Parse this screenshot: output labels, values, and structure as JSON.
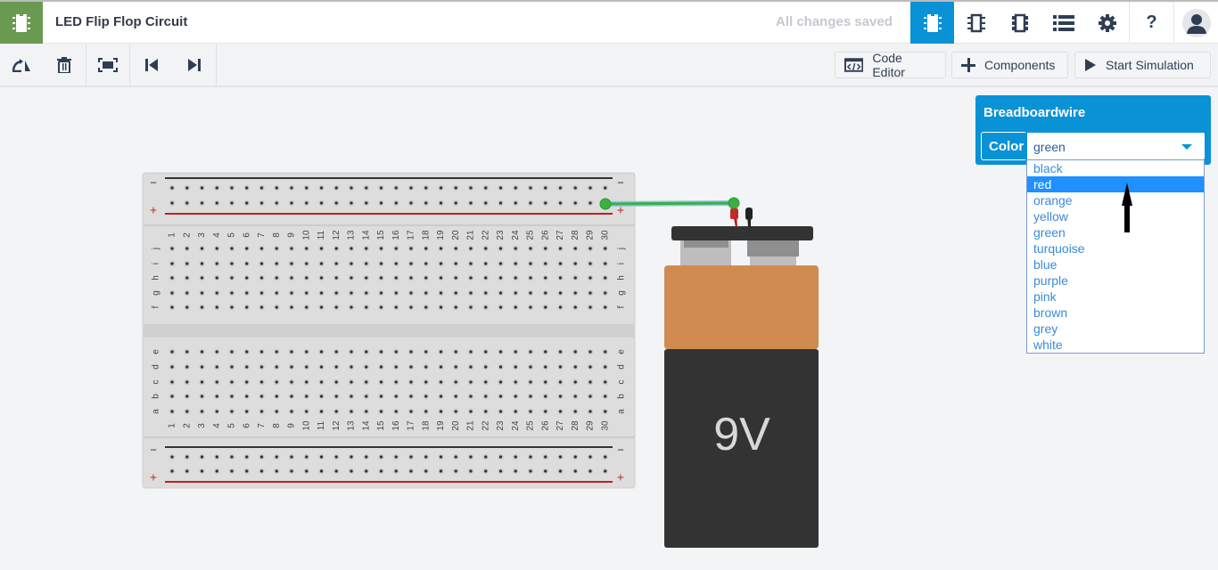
{
  "header": {
    "title": "LED Flip Flop Circuit",
    "status": "All changes saved",
    "icons": [
      "circuit-view-icon",
      "schematic-view-icon",
      "component-list-view-icon",
      "list-icon",
      "settings-icon",
      "help-icon",
      "user-avatar-icon"
    ]
  },
  "toolbar": {
    "code_editor": "Code Editor",
    "components": "Components",
    "start_simulation": "Start Simulation"
  },
  "breadboard": {
    "columns": 30,
    "rows_top": [
      "j",
      "i",
      "h",
      "g",
      "f"
    ],
    "rows_bottom": [
      "e",
      "d",
      "c",
      "b",
      "a"
    ],
    "minus": "−",
    "plus": "+"
  },
  "battery": {
    "label": "9V"
  },
  "inspector": {
    "title": "Breadboardwire",
    "color_label": "Color",
    "color_value": "green",
    "options": [
      "black",
      "red",
      "orange",
      "yellow",
      "green",
      "turquoise",
      "blue",
      "purple",
      "pink",
      "brown",
      "grey",
      "white"
    ],
    "highlighted": "red"
  },
  "colors": {
    "accent": "#0a92d6",
    "brand": "#6a9a50",
    "wire": "#3cb043",
    "battery_top": "#d08c50",
    "battery_body": "#333333"
  }
}
